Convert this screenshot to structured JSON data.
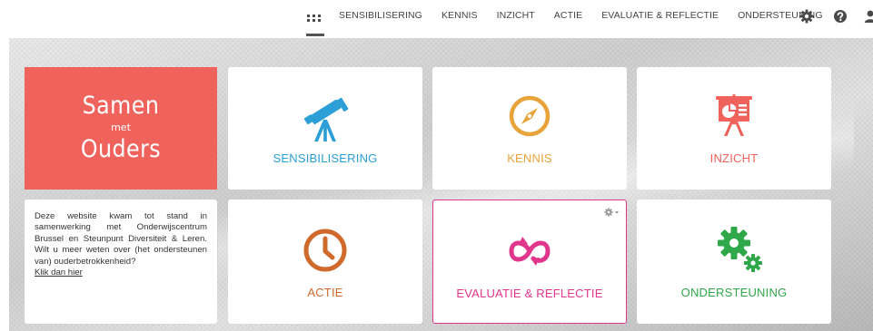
{
  "nav": {
    "items": [
      {
        "label": "SENSIBILISERING"
      },
      {
        "label": "KENNIS"
      },
      {
        "label": "INZICHT"
      },
      {
        "label": "ACTIE"
      },
      {
        "label": "EVALUATIE & REFLECTIE"
      },
      {
        "label": "ONDERSTEUNING"
      }
    ],
    "icons": [
      "apps-grid-icon",
      "gear-icon",
      "help-icon",
      "user-icon"
    ]
  },
  "logo": {
    "line1": "Samen",
    "line2": "met",
    "line3": "Ouders",
    "color": "#f0635c"
  },
  "info": {
    "text": "Deze website kwam tot stand in samenwerking met Onderwijscentrum Brussel en Steunpunt Diversiteit & Leren. Wilt u meer weten over (het ondersteunen van) ouderbetrokkenheid?",
    "link": "Klik dan hier"
  },
  "tiles": [
    {
      "label": "SENSIBILISERING",
      "icon": "telescope-icon",
      "color": "#2b9fd6"
    },
    {
      "label": "KENNIS",
      "icon": "compass-icon",
      "color": "#e8a33b"
    },
    {
      "label": "INZICHT",
      "icon": "presentation-chart-icon",
      "color": "#f0635c"
    },
    {
      "label": "ACTIE",
      "icon": "clock-icon",
      "color": "#cf6a2c"
    },
    {
      "label": "EVALUATIE & REFLECTIE",
      "icon": "cycle-arrows-icon",
      "color": "#e0368b"
    },
    {
      "label": "ONDERSTEUNING",
      "icon": "gears-icon",
      "color": "#2fa84a"
    }
  ]
}
